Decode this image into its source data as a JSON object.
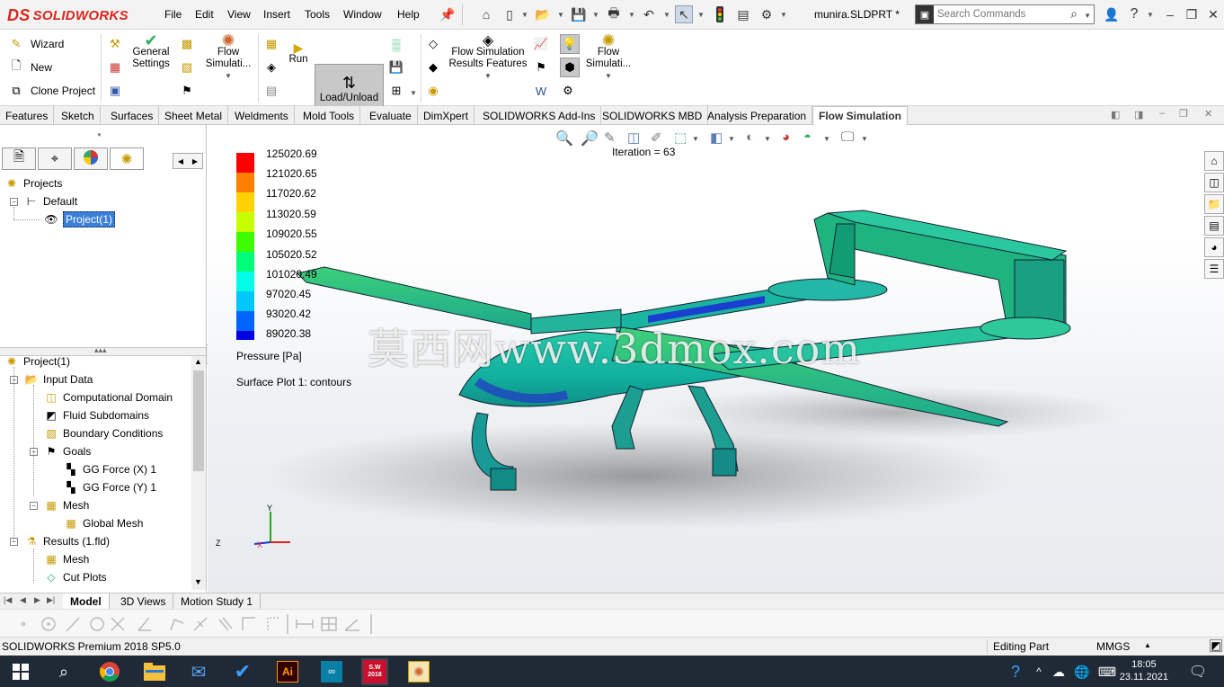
{
  "titlebar": {
    "brand": "SOLIDWORKS",
    "brand_prefix": "DS",
    "menu": [
      "File",
      "Edit",
      "View",
      "Insert",
      "Tools",
      "Window",
      "Help"
    ],
    "document": "munira.SLDPRT *",
    "search_placeholder": "Search Commands"
  },
  "ribbon": {
    "wizard": "Wizard",
    "new": "New",
    "clone": "Clone Project",
    "general_settings": [
      "General",
      "Settings"
    ],
    "flow_sim_1": [
      "Flow",
      "Simulati..."
    ],
    "run": "Run",
    "load_unload": "Load/Unload",
    "results_features": [
      "Flow Simulation",
      "Results Features"
    ],
    "flow_sim_2": [
      "Flow",
      "Simulati..."
    ]
  },
  "tabs": [
    "Features",
    "Sketch",
    "Surfaces",
    "Sheet Metal",
    "Weldments",
    "Mold Tools",
    "Evaluate",
    "DimXpert",
    "SOLIDWORKS Add-Ins",
    "SOLIDWORKS MBD",
    "Analysis Preparation",
    "Flow Simulation"
  ],
  "active_tab": "Flow Simulation",
  "projects_tree": {
    "root": "Projects",
    "config": "Default",
    "project": "Project(1)"
  },
  "analysis_tree": {
    "root": "Project(1)",
    "items": [
      {
        "label": "Input Data",
        "level": 1
      },
      {
        "label": "Computational Domain",
        "level": 2
      },
      {
        "label": "Fluid Subdomains",
        "level": 2
      },
      {
        "label": "Boundary Conditions",
        "level": 2
      },
      {
        "label": "Goals",
        "level": 2
      },
      {
        "label": "GG Force (X) 1",
        "level": 3
      },
      {
        "label": "GG Force (Y) 1",
        "level": 3
      },
      {
        "label": "Mesh",
        "level": 2
      },
      {
        "label": "Global Mesh",
        "level": 3
      },
      {
        "label": "Results (1.fld)",
        "level": 1
      },
      {
        "label": "Mesh",
        "level": 2
      },
      {
        "label": "Cut Plots",
        "level": 2
      }
    ]
  },
  "legend": {
    "values": [
      "125020.69",
      "121020.65",
      "117020.62",
      "113020.59",
      "109020.55",
      "105020.52",
      "101020.49",
      "97020.45",
      "93020.42",
      "89020.38"
    ],
    "colors": [
      "#ff0000",
      "#ff7f00",
      "#ffd200",
      "#c8ff00",
      "#3cff00",
      "#00ff78",
      "#00ffe6",
      "#00c8ff",
      "#0064ff",
      "#0000e6"
    ],
    "title": "Pressure [Pa]",
    "plot_name": "Surface Plot 1: contours"
  },
  "iteration": "Iteration = 63",
  "watermark": "莫西网www.3dmox.com",
  "triad": {
    "x": "X",
    "y": "Y",
    "z": "Z"
  },
  "model_tabs": [
    "Model",
    "3D Views",
    "Motion Study 1"
  ],
  "status": {
    "product": "SOLIDWORKS Premium 2018 SP5.0",
    "mode": "Editing Part",
    "units": "MMGS"
  },
  "taskbar": {
    "time": "18:05",
    "date": "23.11.2021",
    "ai_label": "Ai",
    "sw_label": "S.W 2018"
  }
}
